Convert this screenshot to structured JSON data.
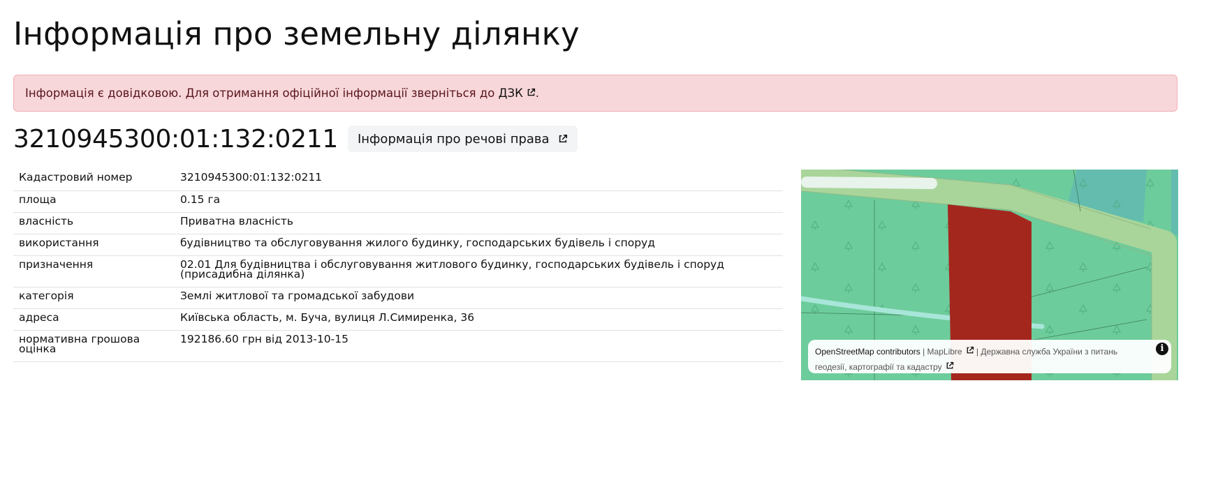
{
  "page": {
    "title": "Інформація про земельну ділянку"
  },
  "alert": {
    "text": "Інформація є довідковою. Для отримання офіційної інформації зверніться до",
    "link_label": "ДЗК",
    "suffix": "."
  },
  "parcel": {
    "number": "3210945300:01:132:0211",
    "rights_button": "Інформація про речові права"
  },
  "info_table": [
    {
      "key": "Кадастровий номер",
      "value": "3210945300:01:132:0211"
    },
    {
      "key": "площа",
      "value": "0.15 га"
    },
    {
      "key": "власність",
      "value": "Приватна власність"
    },
    {
      "key": "використання",
      "value": "будівництво та обслуговування жилого будинку, господарських будівель і споруд"
    },
    {
      "key": "призначення",
      "value": "02.01 Для будівництва і обслуговування житлового будинку, господарських будівель і споруд (присадибна ділянка)"
    },
    {
      "key": "категорія",
      "value": "Землі житлової та громадської забудови"
    },
    {
      "key": "адреса",
      "value": "Київська область, м. Буча, вулиця Л.Симиренка, 36"
    },
    {
      "key": "нормативна грошова оцінка",
      "value": "192186.60 грн від 2013-10-15"
    }
  ],
  "map": {
    "attribution": {
      "osm": "OpenStreetMap contributors",
      "sep1": " | ",
      "maplibre": "MapLibre",
      "sep2": " | ",
      "cadastre": "Державна служба України з питань геодезії, картографії та кадастру"
    },
    "info_icon": "info-icon",
    "colors": {
      "forest": "#6dcc9b",
      "road": "#a9d59a",
      "parcel": "#a4271e",
      "dark_green": "#63bcae"
    }
  },
  "icons": {
    "external_link": "external-link-icon"
  },
  "colors": {
    "alert_bg": "#f8d7da",
    "alert_border": "#f1aeb5",
    "alert_text": "#58151c"
  }
}
